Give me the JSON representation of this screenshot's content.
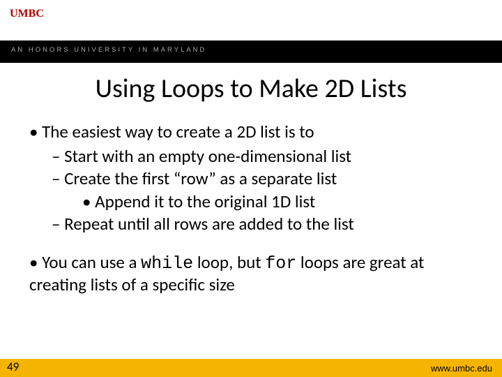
{
  "header": {
    "logo": "UMBC",
    "tagline": "AN HONORS UNIVERSITY IN MARYLAND"
  },
  "title": "Using Loops to Make 2D Lists",
  "bullets": {
    "b1": "The easiest way to create a 2D list is to",
    "b1a": "Start with an empty one-dimensional list",
    "b1b": "Create the first “row” as a separate list",
    "b1b1": "Append it to the original 1D list",
    "b1c": "Repeat until all rows are added to the list",
    "b2_pre": "You can use a ",
    "b2_code1": "while",
    "b2_mid": " loop, but ",
    "b2_code2": "for",
    "b2_post": " loops are great at creating lists of a specific size"
  },
  "footer": {
    "page": "49",
    "url": "www.umbc.edu"
  }
}
